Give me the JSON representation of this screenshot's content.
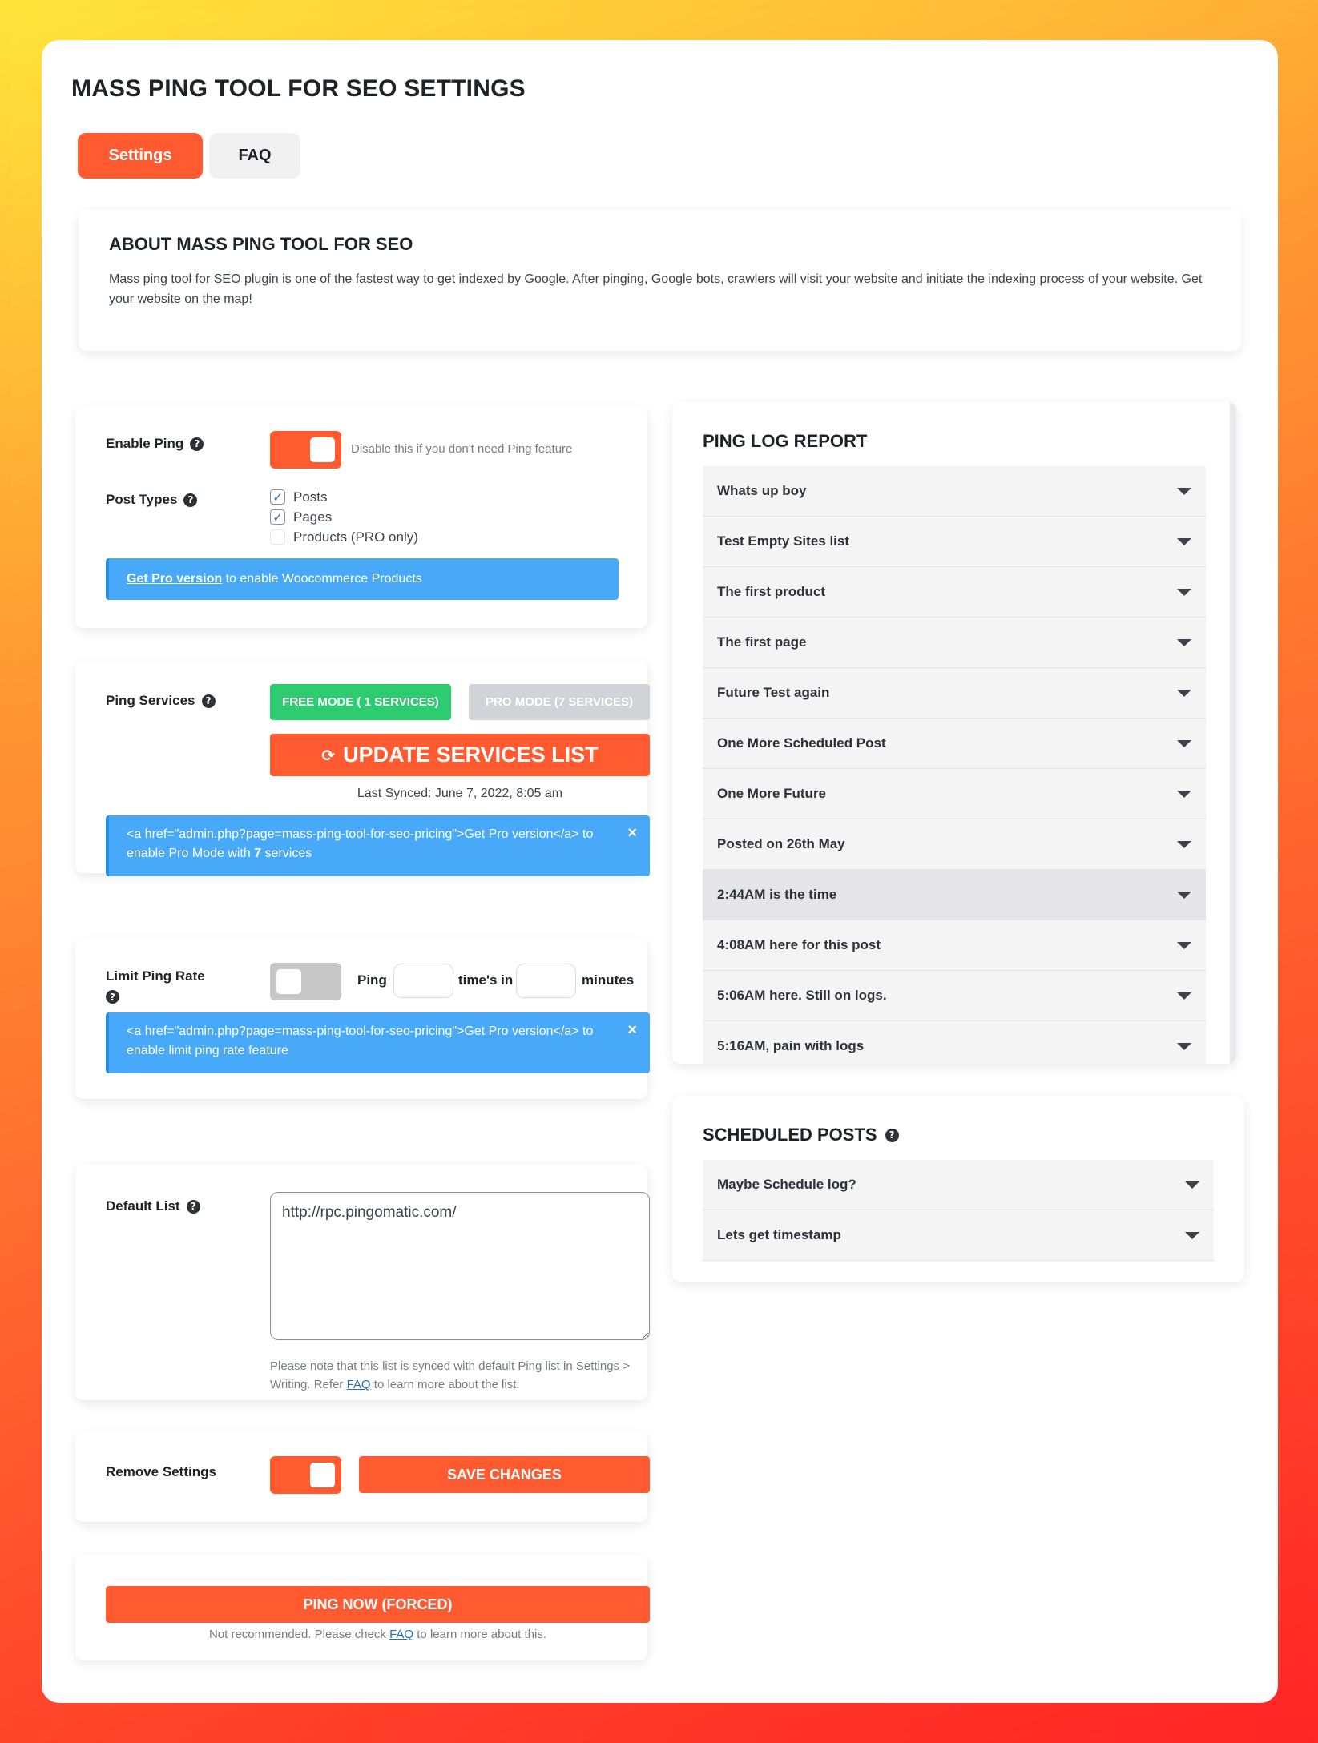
{
  "page": {
    "title": "MASS PING TOOL FOR SEO SETTINGS",
    "tabs": [
      {
        "label": "Settings",
        "active": true
      },
      {
        "label": "FAQ",
        "active": false
      }
    ]
  },
  "about": {
    "title": "ABOUT MASS PING TOOL FOR SEO",
    "text": "Mass ping tool for SEO plugin is one of the fastest way to get indexed by Google. After pinging, Google bots, crawlers will visit your website and initiate the indexing process of your website. Get your website on the map!"
  },
  "enable_ping": {
    "label": "Enable Ping",
    "enabled": true,
    "hint": "Disable this if you don't need Ping feature"
  },
  "post_types": {
    "label": "Post Types",
    "options": [
      {
        "label": "Posts",
        "checked": true
      },
      {
        "label": "Pages",
        "checked": true
      },
      {
        "label": "Products (PRO only)",
        "checked": false
      }
    ],
    "notice_link": "Get Pro version",
    "notice_rest": " to enable Woocommerce Products"
  },
  "ping_services": {
    "label": "Ping Services",
    "free_mode": "FREE MODE ( 1 SERVICES)",
    "pro_mode": "PRO MODE (7 SERVICES)",
    "update_button": "UPDATE SERVICES LIST",
    "last_synced": "Last Synced: June 7, 2022, 8:05 am",
    "notice_before": "<a href=\"admin.php?page=mass-ping-tool-for-seo-pricing\">Get Pro version</a> to enable Pro Mode with ",
    "notice_count": "7",
    "notice_after": " services",
    "close_icon": "×"
  },
  "limit_ping_rate": {
    "label": "Limit Ping Rate",
    "enabled": false,
    "ping_label": "Ping",
    "times_label": "time's in",
    "minutes_label": "minutes",
    "times_value": "",
    "minutes_value": "",
    "notice": "<a href=\"admin.php?page=mass-ping-tool-for-seo-pricing\">Get Pro version</a> to enable limit ping rate feature",
    "close_icon": "×"
  },
  "default_list": {
    "label": "Default List",
    "value": "http://rpc.pingomatic.com/",
    "note_before": "Please note that this list is synced with default Ping list in Settings > Writing. Refer ",
    "note_link": "FAQ",
    "note_after": " to learn more about the list."
  },
  "remove_settings": {
    "label": "Remove Settings",
    "enabled": true,
    "save_button": "SAVE CHANGES"
  },
  "ping_now": {
    "button": "PING NOW (FORCED)",
    "note_before": "Not recommended. Please check ",
    "note_link": "FAQ",
    "note_after": " to learn more about this."
  },
  "ping_log": {
    "title": "PING LOG REPORT",
    "items": [
      "Whats up boy",
      "Test Empty Sites list",
      "The first product",
      "The first page",
      "Future Test again",
      "One More Scheduled Post",
      "One More Future",
      "Posted on 26th May",
      "2:44AM is the time",
      "4:08AM here for this post",
      "5:06AM here. Still on logs.",
      "5:16AM, pain with logs"
    ],
    "active_index": 8
  },
  "scheduled_posts": {
    "title": "SCHEDULED POSTS",
    "items": [
      "Maybe Schedule log?",
      "Lets get timestamp"
    ]
  },
  "colors": {
    "accent": "#ff5a30",
    "free_mode": "#2ecc71",
    "pro_mode": "#d0d3d8",
    "notice": "#48a9f8"
  }
}
